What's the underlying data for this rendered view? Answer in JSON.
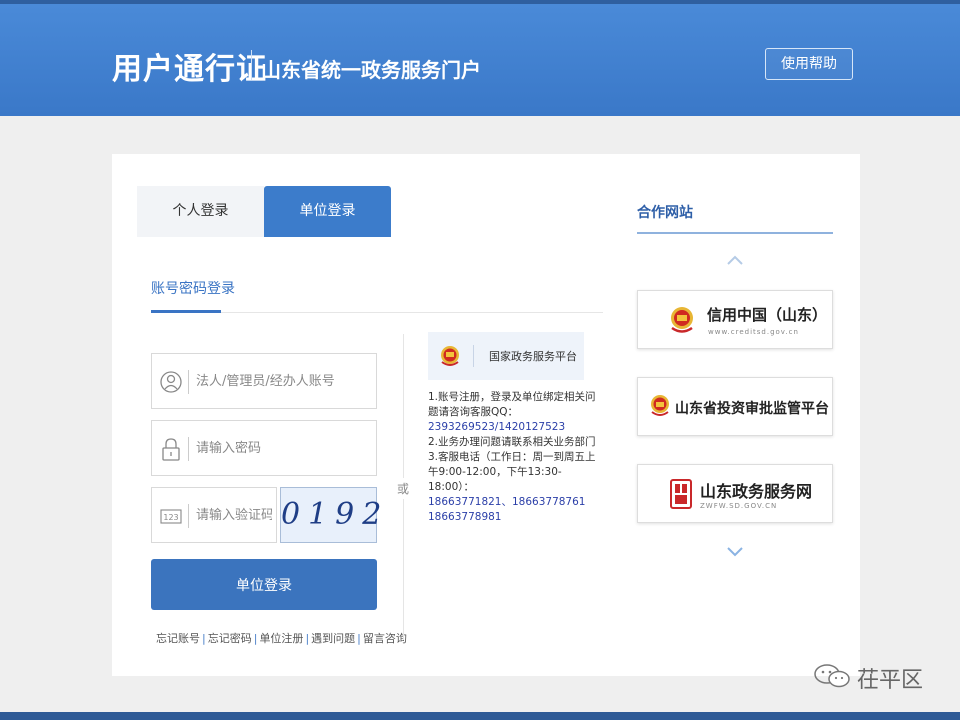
{
  "header": {
    "title": "用户通行证",
    "subtitle": "山东省统一政务服务门户",
    "help_label": "使用帮助",
    "color": "#3a78c8"
  },
  "login": {
    "tabs": [
      {
        "label": "个人登录",
        "active": false
      },
      {
        "label": "单位登录",
        "active": true
      }
    ],
    "subtab_label": "账号密码登录",
    "account_placeholder": "法人/管理员/经办人账号",
    "password_placeholder": "请输入密码",
    "captcha_placeholder": "请输入验证码",
    "captcha_text": "0192",
    "submit_label": "单位登录",
    "links": [
      "忘记账号",
      "忘记密码",
      "单位注册",
      "遇到问题",
      "留言咨询"
    ],
    "icons": [
      "user-icon",
      "lock-icon",
      "captcha-123-icon"
    ]
  },
  "or_label": "或",
  "gov_platform": {
    "name": "国家政务服务平台",
    "icon": "national-emblem-icon"
  },
  "info": {
    "line1": "1.账号注册，登录及单位绑定相关问题请咨询客服QQ：",
    "qq": "2393269523/1420127523",
    "line2": "2.业务办理问题请联系相关业务部门",
    "line3": "3.客服电话（工作日：周一到周五上午9:00-12:00，下午13:30-18:00）：",
    "phones": "18663771821、18663778761",
    "phone3": "18663778981"
  },
  "partners": {
    "title": "合作网站",
    "items": [
      {
        "name": "信用中国（山东）",
        "sub": "www.creditsd.gov.cn",
        "icon": "national-emblem-icon"
      },
      {
        "name": "山东省投资审批监管平台",
        "sub": "",
        "icon": "national-emblem-icon"
      },
      {
        "name": "山东政务服务网",
        "sub": "ZWFW.SD.GOV.CN",
        "icon": "seal-icon"
      }
    ]
  },
  "watermark": {
    "text": "茌平区"
  }
}
